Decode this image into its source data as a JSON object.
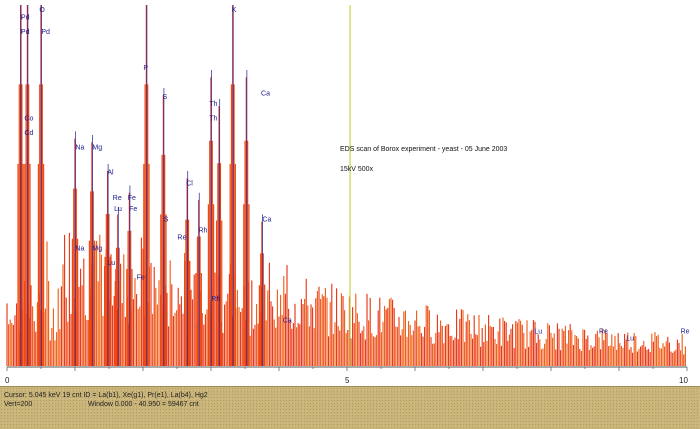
{
  "chart_data": {
    "type": "bar",
    "annotation_title": "EDS scan of Borox experiment - yeast - 05 June 2003",
    "annotation_sub": "15kV 500x",
    "xlim": [
      0,
      10
    ],
    "ylim": [
      0,
      100
    ],
    "x_ticks": [
      "0",
      "5",
      "10"
    ],
    "cursor_x": 5.045,
    "peaks": [
      {
        "x": 0.2,
        "y": 100
      },
      {
        "x": 0.3,
        "y": 100
      },
      {
        "x": 0.5,
        "y": 100
      },
      {
        "x": 1.0,
        "y": 63
      },
      {
        "x": 1.25,
        "y": 62
      },
      {
        "x": 1.48,
        "y": 54
      },
      {
        "x": 1.63,
        "y": 42
      },
      {
        "x": 1.8,
        "y": 48
      },
      {
        "x": 2.05,
        "y": 100
      },
      {
        "x": 2.3,
        "y": 75
      },
      {
        "x": 2.65,
        "y": 52
      },
      {
        "x": 2.82,
        "y": 46
      },
      {
        "x": 3.0,
        "y": 80
      },
      {
        "x": 3.12,
        "y": 72
      },
      {
        "x": 3.32,
        "y": 100
      },
      {
        "x": 3.52,
        "y": 80
      },
      {
        "x": 3.75,
        "y": 40
      }
    ],
    "element_labels": [
      {
        "text": "Pd",
        "x": 0.25,
        "y": 96
      },
      {
        "text": "O",
        "x": 0.52,
        "y": 98
      },
      {
        "text": "Pd",
        "x": 0.25,
        "y": 92
      },
      {
        "text": "Pd",
        "x": 0.55,
        "y": 92
      },
      {
        "text": "Co",
        "x": 0.3,
        "y": 68
      },
      {
        "text": "Cd",
        "x": 0.3,
        "y": 64
      },
      {
        "text": "Na",
        "x": 1.05,
        "y": 60
      },
      {
        "text": "Mg",
        "x": 1.3,
        "y": 60
      },
      {
        "text": "Al",
        "x": 1.52,
        "y": 53
      },
      {
        "text": "Lu",
        "x": 1.62,
        "y": 43
      },
      {
        "text": "Fe",
        "x": 1.82,
        "y": 46
      },
      {
        "text": "Fe",
        "x": 1.84,
        "y": 43
      },
      {
        "text": "Re",
        "x": 1.6,
        "y": 46
      },
      {
        "text": "Na",
        "x": 1.05,
        "y": 32
      },
      {
        "text": "Mg",
        "x": 1.3,
        "y": 32
      },
      {
        "text": "Lu",
        "x": 1.52,
        "y": 28
      },
      {
        "text": "Fe",
        "x": 1.95,
        "y": 24
      },
      {
        "text": "Re",
        "x": 2.55,
        "y": 35
      },
      {
        "text": "P",
        "x": 2.05,
        "y": 82
      },
      {
        "text": "S",
        "x": 2.33,
        "y": 74
      },
      {
        "text": "S",
        "x": 2.35,
        "y": 40
      },
      {
        "text": "Cl",
        "x": 2.68,
        "y": 50
      },
      {
        "text": "Rh",
        "x": 2.86,
        "y": 37
      },
      {
        "text": "Th",
        "x": 3.02,
        "y": 72
      },
      {
        "text": "Th",
        "x": 3.02,
        "y": 68
      },
      {
        "text": "K",
        "x": 3.35,
        "y": 98
      },
      {
        "text": "Ca",
        "x": 3.78,
        "y": 75
      },
      {
        "text": "Ca",
        "x": 3.8,
        "y": 40
      },
      {
        "text": "Rh",
        "x": 3.05,
        "y": 18
      },
      {
        "text": "Ca",
        "x": 4.1,
        "y": 12
      },
      {
        "text": "Lu",
        "x": 7.8,
        "y": 9
      },
      {
        "text": "Re",
        "x": 8.75,
        "y": 9
      },
      {
        "text": "Lu",
        "x": 9.15,
        "y": 7
      },
      {
        "text": "Re",
        "x": 9.95,
        "y": 9
      }
    ]
  },
  "status": {
    "line1": "Cursor: 5.045 keV   19 cnt ID = La(b1), Xe(g1), Pr(e1), La(b4), Hg2",
    "line2_left": "Vert=200",
    "line2_right": "Window 0.000 - 40.950 =   59467 cnt"
  }
}
